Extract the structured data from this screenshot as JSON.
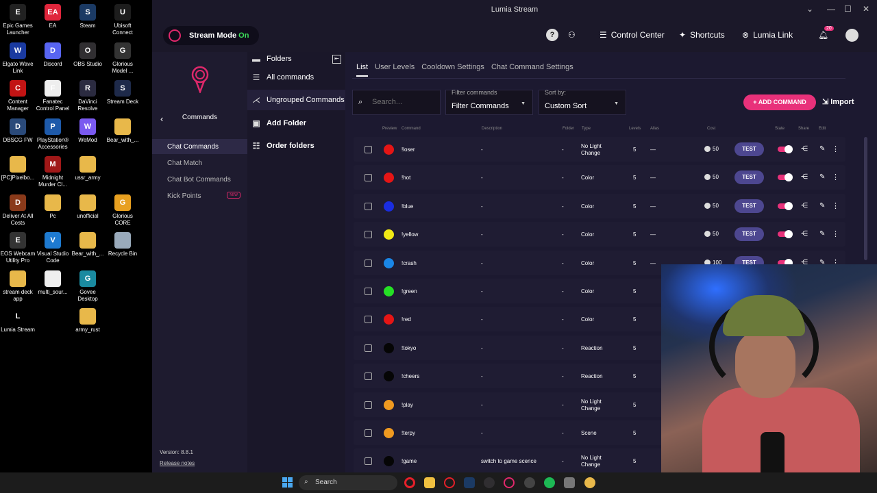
{
  "desktop": {
    "icons": [
      {
        "label": "Epic Games Launcher",
        "glyph": "E",
        "color": "#222"
      },
      {
        "label": "EA",
        "glyph": "EA",
        "color": "#e0263c"
      },
      {
        "label": "Steam",
        "glyph": "S",
        "color": "#1b3a64"
      },
      {
        "label": "Ubisoft Connect",
        "glyph": "U",
        "color": "#1d1d1d"
      },
      {
        "label": "Elgato Wave Link",
        "glyph": "W",
        "color": "#1a3aa0"
      },
      {
        "label": "Discord",
        "glyph": "D",
        "color": "#5865f2"
      },
      {
        "label": "OBS Studio",
        "glyph": "O",
        "color": "#302e31"
      },
      {
        "label": "Glorious Model ...",
        "glyph": "G",
        "color": "#333"
      },
      {
        "label": "Content Manager",
        "glyph": "C",
        "color": "#c21414"
      },
      {
        "label": "Fanatec Control Panel",
        "glyph": "F",
        "color": "#eee"
      },
      {
        "label": "DaVinci Resolve",
        "glyph": "R",
        "color": "#2b2b40"
      },
      {
        "label": "Stream Deck",
        "glyph": "S",
        "color": "#1e2a4a"
      },
      {
        "label": "DBSCG FW",
        "glyph": "D",
        "color": "#2a4a7a"
      },
      {
        "label": "PlayStation® Accessories",
        "glyph": "P",
        "color": "#1e5aaa"
      },
      {
        "label": "WeMod",
        "glyph": "W",
        "color": "#7a5af0"
      },
      {
        "label": "Bear_with_...",
        "glyph": "",
        "color": "#e8b84a"
      },
      {
        "label": "[PC]Pixelbo...",
        "glyph": "",
        "color": "#e8b84a"
      },
      {
        "label": "Midnight Murder Cl...",
        "glyph": "M",
        "color": "#a01818"
      },
      {
        "label": "ussr_army",
        "glyph": "",
        "color": "#e8b84a"
      },
      {
        "label": "",
        "glyph": "",
        "color": "#000"
      },
      {
        "label": "Deliver At All Costs",
        "glyph": "D",
        "color": "#8a3a1a"
      },
      {
        "label": "Pc",
        "glyph": "",
        "color": "#e8b84a"
      },
      {
        "label": "unofficial",
        "glyph": "",
        "color": "#e8b84a"
      },
      {
        "label": "Glorious CORE",
        "glyph": "G",
        "color": "#e8a020"
      },
      {
        "label": "EOS Webcam Utility Pro",
        "glyph": "E",
        "color": "#333"
      },
      {
        "label": "Visual Studio Code",
        "glyph": "V",
        "color": "#1e7ad0"
      },
      {
        "label": "Bear_with_...",
        "glyph": "",
        "color": "#e8b84a"
      },
      {
        "label": "Recycle Bin",
        "glyph": "",
        "color": "#9ab"
      },
      {
        "label": "stream deck app",
        "glyph": "",
        "color": "#e8b84a"
      },
      {
        "label": "multi_sour...",
        "glyph": "",
        "color": "#eee"
      },
      {
        "label": "Govee Desktop",
        "glyph": "G",
        "color": "#1a8aa0"
      },
      {
        "label": "",
        "glyph": "",
        "color": "#000"
      },
      {
        "label": "Lumia Stream",
        "glyph": "L",
        "color": "#000"
      },
      {
        "label": "",
        "glyph": "",
        "color": "#000"
      },
      {
        "label": "army_rust",
        "glyph": "",
        "color": "#e8b84a"
      }
    ]
  },
  "window": {
    "title": "Lumia Stream",
    "minimize": "⌄",
    "min": "—",
    "max": "☐",
    "close": "✕"
  },
  "topbar": {
    "stream_mode": "Stream Mode",
    "stream_state": "On",
    "help": "?",
    "control_center": "Control Center",
    "shortcuts": "Shortcuts",
    "lumia_link": "Lumia Link",
    "notif_count": "20"
  },
  "leftnav": {
    "back": "‹",
    "title": "Commands",
    "items": [
      {
        "label": "Chat Commands",
        "active": true
      },
      {
        "label": "Chat Match"
      },
      {
        "label": "Chat Bot Commands"
      },
      {
        "label": "Kick Points",
        "badge": "NEW"
      }
    ],
    "version": "Version: 8.8.1",
    "release": "Release notes"
  },
  "folders": {
    "title": "Folders",
    "all": "All commands",
    "ungrouped": "Ungrouped Commands",
    "add": "Add Folder",
    "order": "Order folders"
  },
  "tabs": [
    "List",
    "User Levels",
    "Cooldown Settings",
    "Chat Command Settings"
  ],
  "search": {
    "placeholder": "Search..."
  },
  "filter": {
    "label": "Filter commands",
    "value": "Filter Commands"
  },
  "sort": {
    "label": "Sort by:",
    "value": "Custom Sort"
  },
  "add_command": "+ ADD COMMAND",
  "import": "Import",
  "header": {
    "preview": "Preview",
    "command": "Command",
    "description": "Description",
    "folder": "Folder",
    "type": "Type",
    "levels": "Levels",
    "alias": "Alias",
    "cost": "Cost",
    "state": "State",
    "share": "Share",
    "edit": "Edit"
  },
  "test_label": "TEST",
  "rows": [
    {
      "cmd": "!loser",
      "color": "#e51515",
      "desc": "-",
      "folder": "-",
      "type": "No Light Change",
      "levels": "5",
      "alias": "—",
      "cost": "50"
    },
    {
      "cmd": "!hot",
      "color": "#e51515",
      "desc": "-",
      "folder": "-",
      "type": "Color",
      "levels": "5",
      "alias": "—",
      "cost": "50"
    },
    {
      "cmd": "!blue",
      "color": "#1a2de0",
      "desc": "-",
      "folder": "-",
      "type": "Color",
      "levels": "5",
      "alias": "—",
      "cost": "50"
    },
    {
      "cmd": "!yellow",
      "color": "#f0e815",
      "desc": "-",
      "folder": "-",
      "type": "Color",
      "levels": "5",
      "alias": "—",
      "cost": "50"
    },
    {
      "cmd": "!crash",
      "color": "#1a86e6",
      "desc": "-",
      "folder": "-",
      "type": "Color",
      "levels": "5",
      "alias": "—",
      "cost": "100"
    },
    {
      "cmd": "!green",
      "color": "#25e025",
      "desc": "-",
      "folder": "-",
      "type": "Color",
      "levels": "5",
      "alias": "",
      "cost": ""
    },
    {
      "cmd": "!red",
      "color": "#e51515",
      "desc": "-",
      "folder": "-",
      "type": "Color",
      "levels": "5",
      "alias": "",
      "cost": ""
    },
    {
      "cmd": "!tokyo",
      "color": "#050505",
      "desc": "-",
      "folder": "-",
      "type": "Reaction",
      "levels": "5",
      "alias": "",
      "cost": ""
    },
    {
      "cmd": "!cheers",
      "color": "#050505",
      "desc": "-",
      "folder": "-",
      "type": "Reaction",
      "levels": "5",
      "alias": "",
      "cost": ""
    },
    {
      "cmd": "!play",
      "color": "#f09a20",
      "desc": "-",
      "folder": "-",
      "type": "No Light Change",
      "levels": "5",
      "alias": "",
      "cost": ""
    },
    {
      "cmd": "!terpy",
      "color": "#f09a20",
      "desc": "-",
      "folder": "-",
      "type": "Scene",
      "levels": "5",
      "alias": "",
      "cost": ""
    },
    {
      "cmd": "!game",
      "color": "#050505",
      "desc": "switch to game scence",
      "folder": "-",
      "type": "No Light Change",
      "levels": "5",
      "alias": "",
      "cost": ""
    }
  ],
  "taskbar": {
    "search": "Search"
  }
}
